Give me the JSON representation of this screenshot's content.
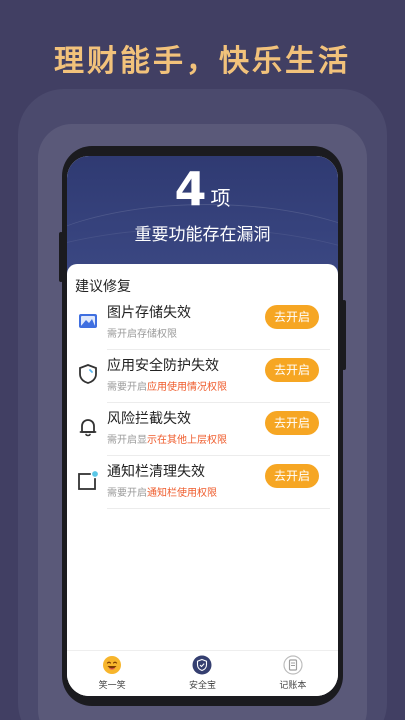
{
  "promo": {
    "title": "理财能手，快乐生活"
  },
  "header": {
    "count": "4",
    "unit": "项",
    "subtitle": "重要功能存在漏洞"
  },
  "card": {
    "section_title": "建议修复",
    "items": [
      {
        "name": "图片存储失效",
        "desc_plain": "需开启存储权限",
        "desc_highlight": "",
        "button": "去开启",
        "icon": "image-icon"
      },
      {
        "name": "应用安全防护失效",
        "desc_plain": "需要开启",
        "desc_highlight": "应用使用情况权限",
        "button": "去开启",
        "icon": "shield-icon"
      },
      {
        "name": "风险拦截失效",
        "desc_plain": "需开启显",
        "desc_highlight": "示在其他上层权限",
        "button": "去开启",
        "icon": "bell-icon"
      },
      {
        "name": "通知栏清理失效",
        "desc_plain": "需要开启",
        "desc_highlight": "通知栏使用权限",
        "button": "去开启",
        "icon": "notification-icon"
      }
    ]
  },
  "tabs": [
    {
      "label": "笑一笑",
      "icon": "smile-icon"
    },
    {
      "label": "安全宝",
      "icon": "shield-icon",
      "active": true
    },
    {
      "label": "记账本",
      "icon": "ledger-icon"
    }
  ],
  "colors": {
    "accent": "#f6a623",
    "highlight": "#ef5b2b",
    "header": "#2f3a72",
    "background": "#413f63",
    "promo": "#f2c27b"
  }
}
